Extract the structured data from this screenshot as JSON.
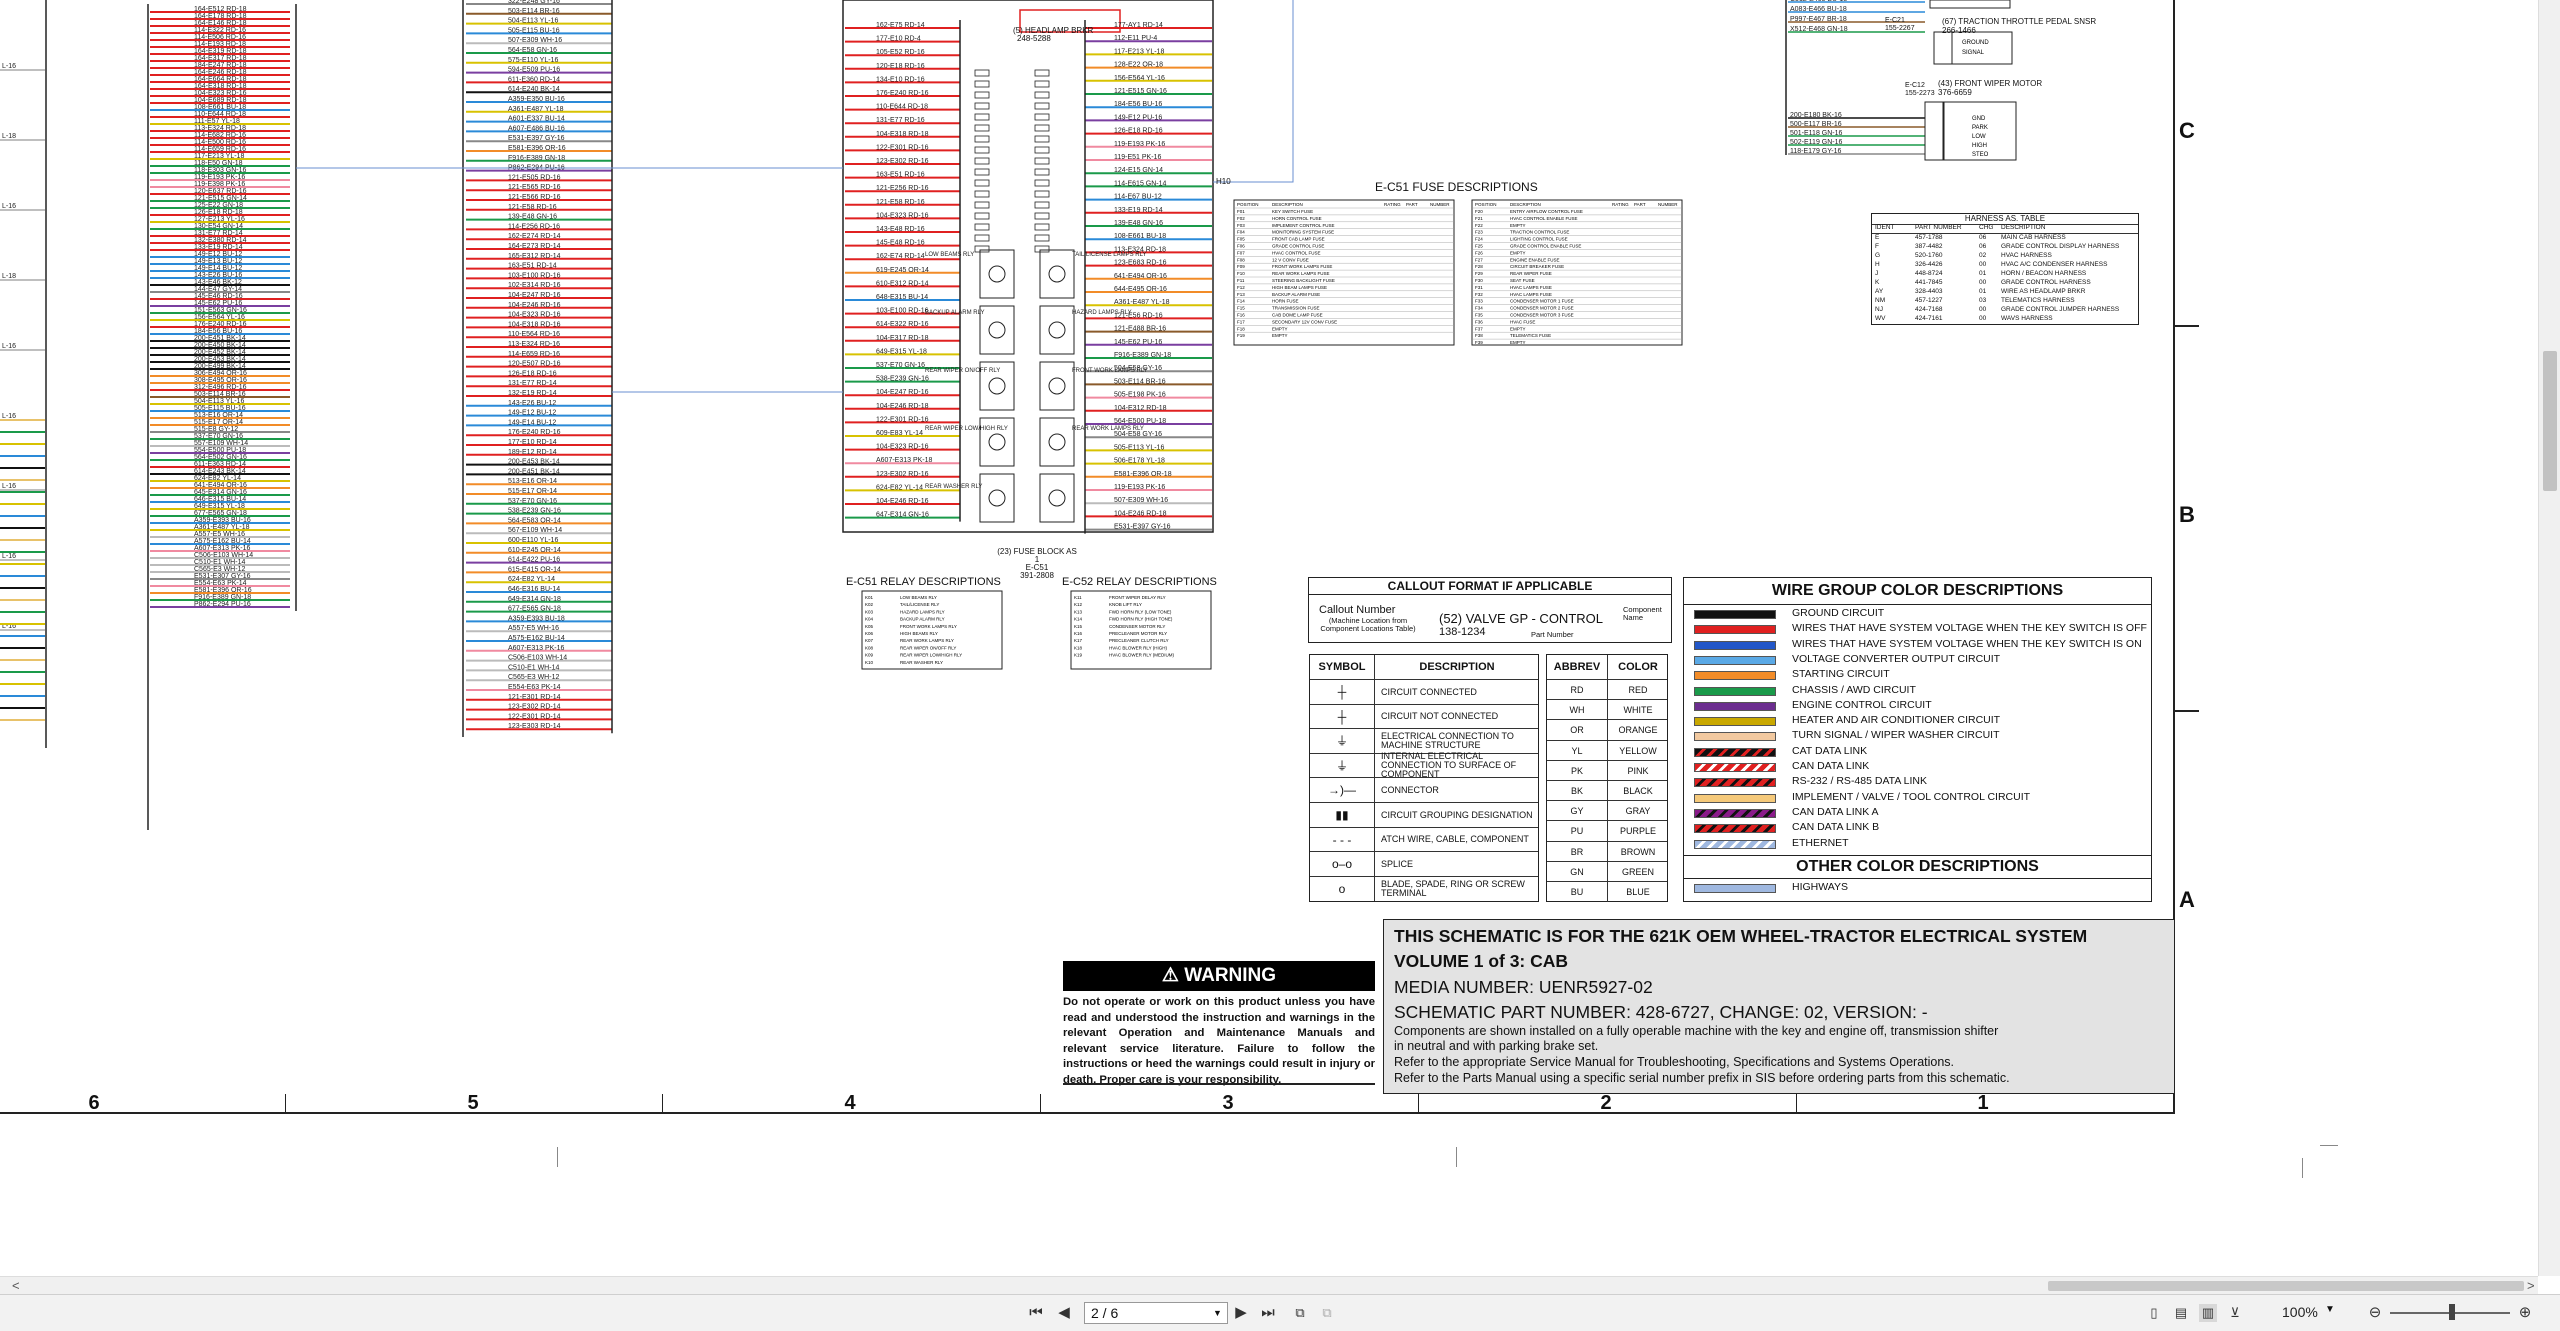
{
  "schematic": {
    "zone_numbers": [
      "6",
      "5",
      "4",
      "3",
      "2",
      "1"
    ],
    "zone_letters": [
      "C",
      "B",
      "A"
    ],
    "fuse_descriptions_title": "E-C51 FUSE DESCRIPTIONS",
    "relay_e_c51_title": "E-C51 RELAY DESCRIPTIONS",
    "relay_e_c52_title": "E-C52 RELAY DESCRIPTIONS",
    "fuse_block_caption": "(23) FUSE BLOCK AS 1",
    "fuse_block_ids": [
      "E-C51",
      "391-2808"
    ],
    "headlamp_label": "(5) HEADLAMP BRKR",
    "headlamp_part": "248-5288",
    "front_wiper_motor": "(43) FRONT WIPER MOTOR",
    "front_wiper_part": "376-6659",
    "front_wiper_ids": [
      "E-C12",
      "155-2273"
    ],
    "throttle_pedal": "(67) TRACTION THROTTLE PEDAL SNSR",
    "throttle_part": "266-1466",
    "throttle_ids": [
      "E-C21",
      "155-2267"
    ],
    "motor_pins": [
      "GND",
      "PARK",
      "LOW",
      "HIGH",
      "STEO"
    ],
    "throttle_pins": [
      "GROUND",
      "SIGNAL"
    ],
    "relay_labels": [
      "LOW BEAMS RLY",
      "TAIL/LICENSE LAMPS RLY",
      "BACKUP ALARM RLY",
      "HAZARD LAMPS RLY",
      "REAR WIPER ON/OFF RLY",
      "FRONT WORK LAMPS RLY",
      "REAR WIPER LOW/HIGH RLY",
      "REAR WORK LAMPS RLY",
      "REAR WASHER RLY"
    ],
    "harness_table": {
      "title": "HARNESS AS. TABLE",
      "headers": [
        "IDENT",
        "PART NUMBER",
        "CHG",
        "DESCRIPTION"
      ],
      "rows": [
        [
          "E",
          "457-1788",
          "06",
          "MAIN CAB HARNESS"
        ],
        [
          "F",
          "387-4482",
          "06",
          "GRADE CONTROL DISPLAY HARNESS"
        ],
        [
          "G",
          "520-1760",
          "02",
          "HVAC HARNESS"
        ],
        [
          "H",
          "326-4426",
          "00",
          "HVAC A/C CONDENSER HARNESS"
        ],
        [
          "J",
          "448-8724",
          "01",
          "HORN / BEACON HARNESS"
        ],
        [
          "K",
          "441-7845",
          "00",
          "GRADE CONTROL HARNESS"
        ],
        [
          "AY",
          "328-4403",
          "01",
          "WIRE AS HEADLAMP BRKR"
        ],
        [
          "NM",
          "457-1227",
          "03",
          "TELEMATICS HARNESS"
        ],
        [
          "NJ",
          "424-7168",
          "00",
          "GRADE CONTROL JUMPER HARNESS"
        ],
        [
          "WV",
          "424-7161",
          "00",
          "WAVS HARNESS"
        ]
      ]
    },
    "callout": {
      "title": "CALLOUT FORMAT IF APPLICABLE",
      "callout_number": "Callout Number",
      "machine_location": "(Machine Location from",
      "component_locations": "Component Locations Table)",
      "example": "(52) VALVE GP - CONTROL",
      "part_example": "138-1234",
      "component_name": "Component Name",
      "part_number": "Part Number"
    },
    "symbols": {
      "headers": [
        "SYMBOL",
        "DESCRIPTION"
      ],
      "rows": [
        {
          "icon": "dot-junction-icon",
          "glyph": "┼",
          "desc": "CIRCUIT CONNECTED"
        },
        {
          "icon": "crossing-icon",
          "glyph": "┼",
          "desc": "CIRCUIT NOT CONNECTED"
        },
        {
          "icon": "machine-ground-icon",
          "glyph": "⏚",
          "desc": "ELECTRICAL CONNECTION TO MACHINE STRUCTURE"
        },
        {
          "icon": "component-ground-icon",
          "glyph": "⏚",
          "desc": "INTERNAL ELECTRICAL CONNECTION TO SURFACE OF COMPONENT"
        },
        {
          "icon": "connector-icon",
          "glyph": "→)—",
          "desc": "CONNECTOR"
        },
        {
          "icon": "grouping-icon",
          "glyph": "▮▮",
          "desc": "CIRCUIT GROUPING DESIGNATION"
        },
        {
          "icon": "attach-wire-icon",
          "glyph": "- - -",
          "desc": "ATCH WIRE, CABLE, COMPONENT"
        },
        {
          "icon": "splice-icon",
          "glyph": "o–o",
          "desc": "SPLICE"
        },
        {
          "icon": "terminal-icon",
          "glyph": "o",
          "desc": "BLADE, SPADE, RING OR SCREW TERMINAL"
        }
      ]
    },
    "abbrev": {
      "headers": [
        "ABBREV",
        "COLOR"
      ],
      "rows": [
        [
          "RD",
          "RED"
        ],
        [
          "WH",
          "WHITE"
        ],
        [
          "OR",
          "ORANGE"
        ],
        [
          "YL",
          "YELLOW"
        ],
        [
          "PK",
          "PINK"
        ],
        [
          "BK",
          "BLACK"
        ],
        [
          "GY",
          "GRAY"
        ],
        [
          "PU",
          "PURPLE"
        ],
        [
          "BR",
          "BROWN"
        ],
        [
          "GN",
          "GREEN"
        ],
        [
          "BU",
          "BLUE"
        ]
      ]
    },
    "wire_group": {
      "title": "WIRE GROUP COLOR DESCRIPTIONS",
      "other_title": "OTHER COLOR DESCRIPTIONS",
      "rows": [
        {
          "label": "GROUND CIRCUIT",
          "color": "#111111",
          "stripe": ""
        },
        {
          "label": "WIRES THAT HAVE SYSTEM VOLTAGE WHEN THE KEY SWITCH IS OFF",
          "color": "#e02020",
          "stripe": ""
        },
        {
          "label": "WIRES THAT HAVE SYSTEM VOLTAGE WHEN THE KEY SWITCH IS ON",
          "color": "#2357c8",
          "stripe": ""
        },
        {
          "label": "VOLTAGE CONVERTER OUTPUT CIRCUIT",
          "color": "#5aa9e6",
          "stripe": ""
        },
        {
          "label": "STARTING CIRCUIT",
          "color": "#f28c28",
          "stripe": ""
        },
        {
          "label": "CHASSIS / AWD CIRCUIT",
          "color": "#1a9a4a",
          "stripe": ""
        },
        {
          "label": "ENGINE CONTROL CIRCUIT",
          "color": "#6b2d8f",
          "stripe": ""
        },
        {
          "label": "HEATER AND AIR CONDITIONER CIRCUIT",
          "color": "#c9a800",
          "stripe": ""
        },
        {
          "label": "TURN SIGNAL / WIPER WASHER CIRCUIT",
          "color": "#f2c9a0",
          "stripe": ""
        },
        {
          "label": "CAT DATA LINK",
          "color": "#111111",
          "stripe": "#e02020"
        },
        {
          "label": "CAN DATA LINK",
          "color": "#e02020",
          "stripe": "#ffffff"
        },
        {
          "label": "RS-232 / RS-485 DATA LINK",
          "color": "#e02020",
          "stripe": "#111111"
        },
        {
          "label": "IMPLEMENT / VALVE / TOOL CONTROL CIRCUIT",
          "color": "#f5c97a",
          "stripe": ""
        },
        {
          "label": "CAN DATA LINK A",
          "color": "#8a1a8a",
          "stripe": "#111111"
        },
        {
          "label": "CAN DATA LINK B",
          "color": "#e02020",
          "stripe": "#111111"
        },
        {
          "label": "ETHERNET",
          "color": "#9fb8e0",
          "stripe": "#ffffff"
        }
      ],
      "other_rows": [
        {
          "label": "HIGHWAYS",
          "color": "#9fb8e0",
          "stripe": ""
        }
      ]
    },
    "warning": {
      "heading": "WARNING",
      "body": "Do not operate or work on this product unless you have read and understood the instruction and warnings in the relevant Operation and Maintenance Manuals and relevant service literature. Failure to follow the instructions or heed the warnings could result in injury or death. Proper care is your responsibility."
    },
    "title_block": {
      "line1": "THIS SCHEMATIC IS FOR THE 621K OEM WHEEL-TRACTOR ELECTRICAL SYSTEM",
      "line2": "VOLUME 1 of 3: CAB",
      "media": "MEDIA NUMBER: UENR5927-02",
      "part": "SCHEMATIC PART NUMBER: 428-6727, CHANGE: 02, VERSION: -",
      "note1": "Components are shown installed on a fully operable machine with the key and engine off, transmission shifter",
      "note2": "in neutral and with parking brake set.",
      "note3": "Refer to the appropriate Service Manual for Troubleshooting, Specifications and Systems Operations.",
      "note4": "Refer to the Parts Manual using a specific serial number prefix in SIS before ordering parts from this schematic."
    },
    "connector_label": "H10"
  },
  "viewer": {
    "page_display": "2 / 6",
    "zoom": "100%",
    "scroll_left": "<",
    "scroll_right": ">",
    "nav_icons": [
      "first-page-icon",
      "prev-page-icon",
      "next-page-icon",
      "last-page-icon"
    ],
    "view_icons": [
      "single-page-icon",
      "continuous-icon",
      "facing-icon",
      "cover-icon"
    ]
  },
  "wire_labels": {
    "col_a": [
      "164-E512 RD-18",
      "164-E178 RD-18",
      "164-E146 RD-18",
      "114-E322 RD-16",
      "114-E506 RD-16",
      "114-E193 RD-18",
      "164-E319 RD-18",
      "164-E317 RD-18",
      "184-E247 RD-18",
      "164-E246 RD-18",
      "164-E664 RD-18",
      "164-E318 RD-18",
      "104-E323 RD-16",
      "104-E689 RD-18",
      "108-E661 BU-18",
      "110-E644 RD-18",
      "111-E57 YL-18",
      "113-E324 RD-18",
      "114-E682 RD-16",
      "114-E500 RD-16",
      "114-E659 RD-16",
      "117-E213 YL-18",
      "118-E50 GN-18",
      "118-E303 GN-16",
      "119-E193 PK-16",
      "119-E398 PK-16",
      "120-E637 RD-16",
      "121-E515 GN-14",
      "125-E22 GN-18",
      "126-E18 RD-18",
      "127-E213 YL-16",
      "130-E54 GN-14",
      "131-E77 RD-14",
      "132-E380 RD-14",
      "133-E19 RD-14",
      "149-E12 BU-12",
      "149-E13 BU-12",
      "149-E14 BU-12",
      "143-E26 BU-16",
      "143-E46 BK-12",
      "144-E47 GY-14",
      "145-E46 RD-16",
      "145-E62 PU-16",
      "151-E563 GN-16",
      "156-E564 YL-16",
      "176-E240 RD-16",
      "184-E56 BU-16",
      "200-E451 BK-14",
      "200-E450 BK-14",
      "200-E452 BK-14",
      "200-E453 BK-14",
      "200-E499 BK-14",
      "306-E494 OR-16",
      "308-E495 OR-16",
      "312-E496 RD-16",
      "503-E114 BR-16",
      "504-E113 YL-16",
      "505-E115 BU-16",
      "513-E16 OR-14",
      "515-E17 OR-14",
      "515-E8 GY-12",
      "537-E70 GN-16",
      "557-E109 WH-14",
      "554-E500 PU-18",
      "564-E502 GN-16",
      "611-E363 RD-14",
      "614-E243 BK-14",
      "624-E82 YL-14",
      "641-E494 OR-16",
      "645-E314 GN-16",
      "646-E315 BU-14",
      "649-E315 YL-18",
      "677-E565 GN-18",
      "A359-E393 BU-16",
      "A361-E487 YL-18",
      "A557-E5 WH-16",
      "A575-E162 BU-14",
      "A607-E313 PK-16",
      "C506-E103 WH-14",
      "C510-E1 WH-14",
      "C565-E3 WH-12",
      "E531-E307 GY-16",
      "E554-E63 PK-14",
      "E581-E396 OR-16",
      "F916-E389 GN-18",
      "P862-E294 PU-16"
    ],
    "col_b": [
      "322-E248 GY-16",
      "503-E114 BR-16",
      "504-E113 YL-16",
      "505-E115 BU-16",
      "507-E309 WH-16",
      "564-E58 GN-16",
      "575-E110 YL-16",
      "594-E509 PU-16",
      "611-E360 RD-14",
      "614-E240 BK-14",
      "A359-E350 BU-16",
      "A361-E487 YL-18",
      "A601-E337 BU-14",
      "A607-E486 BU-16",
      "E531-E397 GY-16",
      "E581-E396 OR-16",
      "F916-E389 GN-18",
      "P862-E294 PU-16",
      "121-E505 RD-16",
      "121-E565 RD-16",
      "121-E566 RD-16",
      "121-E58 RD-16",
      "139-E48 GN-16",
      "114-E256 RD-16",
      "162-E274 RD-14",
      "164-E273 RD-14",
      "165-E312 RD-14",
      "163-E51 RD-14",
      "103-E100 RD-16",
      "102-E314 RD-16",
      "104-E247 RD-16",
      "104-E246 RD-16",
      "104-E323 RD-16",
      "104-E318 RD-16",
      "110-E564 RD-16",
      "113-E324 RD-16",
      "114-E659 RD-16",
      "120-E507 RD-16",
      "126-E18 RD-16",
      "131-E77 RD-14",
      "132-E19 RD-14",
      "143-E26 BU-12",
      "149-E12 BU-12",
      "149-E14 BU-12",
      "176-E240 RD-16",
      "177-E10 RD-14",
      "189-E12 RD-14",
      "200-E453 BK-14",
      "200-E451 BK-14",
      "513-E16 OR-14",
      "515-E17 OR-14",
      "537-E70 GN-16",
      "538-E239 GN-16",
      "564-E583 OR-14",
      "567-E109 WH-14",
      "600-E110 YL-16",
      "610-E245 OR-14",
      "614-E422 PU-16",
      "615-E415 OR-14",
      "624-E82 YL-14",
      "646-E316 BU-14",
      "649-E314 GN-18",
      "677-E565 GN-18",
      "A359-E393 BU-18",
      "A557-E5 WH-16",
      "A575-E162 BU-14",
      "A607-E313 PK-16",
      "C506-E103 WH-14",
      "C510-E1 WH-14",
      "C565-E3 WH-12",
      "E554-E63 PK-14",
      "121-E301 RD-14",
      "123-E302 RD-14",
      "122-E301 RD-14",
      "123-E303 RD-14"
    ],
    "fuse_left": [
      "162-E75 RD-14",
      "177-E10 RD-4",
      "105-E52 RD-16",
      "120-E18 RD-16",
      "134-E10 RD-16",
      "176-E240 RD-16",
      "110-E644 RD-18",
      "131-E77 RD-16",
      "104-E318 RD-18",
      "122-E301 RD-16",
      "123-E302 RD-16",
      "163-E51 RD-16",
      "121-E256 RD-16",
      "121-E58 RD-16",
      "104-E323 RD-16",
      "143-E48 RD-16",
      "145-E48 RD-16",
      "162-E74 RD-14",
      "619-E245 OR-14",
      "610-E312 RD-14",
      "648-E315 BU-14",
      "103-E100 RD-16",
      "614-E322 RD-16",
      "104-E317 RD-18",
      "649-E315 YL-18",
      "537-E70 GN-16",
      "538-E239 GN-16",
      "104-E247 RD-16",
      "104-E246 RD-18",
      "122-E301 RD-16",
      "609-E83 YL-14",
      "104-E323 RD-16",
      "A607-E313 PK-18",
      "123-E302 RD-16",
      "624-E82 YL-14",
      "104-E246 RD-16",
      "647-E314 GN-16"
    ],
    "fuse_right": [
      "177-AY1 RD-14",
      "112-E11 PU-4",
      "117-E213 YL-18",
      "128-E22 OR-18",
      "156-E564 YL-16",
      "121-E515 GN-16",
      "184-E56 BU-16",
      "149-E12 PU-16",
      "126-E18 RD-16",
      "119-E193 PK-16",
      "119-E51 PK-16",
      "124-E15 GN-14",
      "114-E615 GN-14",
      "114-E67 BU-12",
      "133-E19 RD-14",
      "139-E48 GN-16",
      "108-E661 BU-18",
      "113-E324 RD-18",
      "123-E683 RD-16",
      "641-E494 OR-16",
      "644-E495 OR-16",
      "A361-E487 YL-18",
      "121-E56 RD-16",
      "121-E488 BR-16",
      "145-E62 PU-16",
      "F916-E389 GN-18",
      "504-E58 GY-16",
      "503-E114 BR-16",
      "505-E198 PK-16",
      "104-E312 RD-18",
      "564-E500 PU-18",
      "504-E58 GY-16",
      "505-E113 YL-16",
      "506-E178 YL-18",
      "E581-E396 OR-18",
      "119-E193 PK-16",
      "507-E309 WH-16",
      "104-E246 RD-18",
      "E531-E397 GY-16"
    ],
    "right_top": [
      "C512-E465 BU-18",
      "A083-E466 BU-18",
      "P997-E467 BR-18",
      "X512-E468 GN-18",
      "200-E180 BK-16",
      "500-E117 BR-16",
      "501-E118 GN-16",
      "502-E119 GN-16",
      "118-E179 GY-16"
    ],
    "left_edge": [
      "L-16",
      "L-18",
      "L-16",
      "L-18",
      "L-16",
      "L-16",
      "L-16",
      "L-16",
      "L-16"
    ]
  },
  "fuse_table": {
    "headers": [
      "POSITION",
      "DESCRIPTION",
      "RATING",
      "PART",
      "NUMBER"
    ],
    "left": [
      [
        "F01",
        "KEY SWITCH FUSE"
      ],
      [
        "F02",
        "HORN CONTROL FUSE"
      ],
      [
        "F03",
        "IMPLEMENT CONTROL FUSE"
      ],
      [
        "F04",
        "MONITORING SYSTEM FUSE"
      ],
      [
        "F05",
        "FRONT CAB LAMP FUSE"
      ],
      [
        "F06",
        "GRADE CONTROL FUSE"
      ],
      [
        "F07",
        "HVAC CONTROL FUSE"
      ],
      [
        "F08",
        "12 V CONV FUSE"
      ],
      [
        "F09",
        "FRONT WORK LAMPS FUSE"
      ],
      [
        "F10",
        "REAR WORK LAMPS FUSE"
      ],
      [
        "F11",
        "STEERING BACKLIGHT FUSE"
      ],
      [
        "F12",
        "HIGH BEAM LAMPS FUSE"
      ],
      [
        "F13",
        "BACKUP ALARM FUSE"
      ],
      [
        "F14",
        "HORN FUSE"
      ],
      [
        "F15",
        "TRANSMISSION FUSE"
      ],
      [
        "F16",
        "CAB DOME LAMP FUSE"
      ],
      [
        "F17",
        "SECONDARY 12V CONV FUSE"
      ],
      [
        "F18",
        "EMPTY"
      ],
      [
        "F19",
        "EMPTY"
      ]
    ],
    "right": [
      [
        "F20",
        "ENTRY AIRFLOW CONTROL FUSE"
      ],
      [
        "F21",
        "HVAC CONTROL ENABLE FUSE"
      ],
      [
        "F22",
        "EMPTY"
      ],
      [
        "F23",
        "TRACTION CONTROL FUSE"
      ],
      [
        "F24",
        "LIGHTING CONTROL FUSE"
      ],
      [
        "F25",
        "GRADE CONTROL ENABLE FUSE"
      ],
      [
        "F26",
        "EMPTY"
      ],
      [
        "F27",
        "ENGINE ENABLE FUSE"
      ],
      [
        "F28",
        "CIRCUIT BREAKER FUSE"
      ],
      [
        "F29",
        "REAR WIPER FUSE"
      ],
      [
        "F30",
        "SEAT FUSE"
      ],
      [
        "F31",
        "HVAC LAMPS FUSE"
      ],
      [
        "F32",
        "HVAC LAMPS FUSE"
      ],
      [
        "F33",
        "CONDENSER MOTOR 1 FUSE"
      ],
      [
        "F34",
        "CONDENSER MOTOR 2 FUSE"
      ],
      [
        "F35",
        "CONDENSER MOTOR 3 FUSE"
      ],
      [
        "F36",
        "HVAC FUSE"
      ],
      [
        "F37",
        "EMPTY"
      ],
      [
        "F38",
        "TELEMATICS FUSE"
      ],
      [
        "F39",
        "EMPTY"
      ]
    ]
  },
  "relay_tables": {
    "c51": [
      [
        "K01",
        "LOW BEAMS RLY"
      ],
      [
        "K02",
        "TAIL/LICENSE RLY"
      ],
      [
        "K03",
        "HAZARD LAMPS RLY"
      ],
      [
        "K04",
        "BACKUP ALARM RLY"
      ],
      [
        "K05",
        "FRONT WORK LAMPS RLY"
      ],
      [
        "K06",
        "HIGH BEAMS RLY"
      ],
      [
        "K07",
        "REAR WORK LAMPS RLY"
      ],
      [
        "K08",
        "REAR WIPER ON/OFF RLY"
      ],
      [
        "K09",
        "REAR WIPER LOW/HIGH RLY"
      ],
      [
        "K10",
        "REAR WASHER RLY"
      ]
    ],
    "c52": [
      [
        "K11",
        "FRONT WIPER DELAY RLY"
      ],
      [
        "K12",
        "KNOB LIFT RLY"
      ],
      [
        "K13",
        "FWD HORN RLY (LOW TONE)"
      ],
      [
        "K14",
        "FWD HORN RLY (HIGH TONE)"
      ],
      [
        "K15",
        "CONDENSER MOTOR RLY"
      ],
      [
        "K16",
        "PRECLEANER MOTOR RLY"
      ],
      [
        "K17",
        "PRECLEANER CLUTCH RLY"
      ],
      [
        "K18",
        "HVAC BLOWER RLY (HIGH)"
      ],
      [
        "K19",
        "HVAC BLOWER RLY (MEDIUM)"
      ]
    ]
  }
}
